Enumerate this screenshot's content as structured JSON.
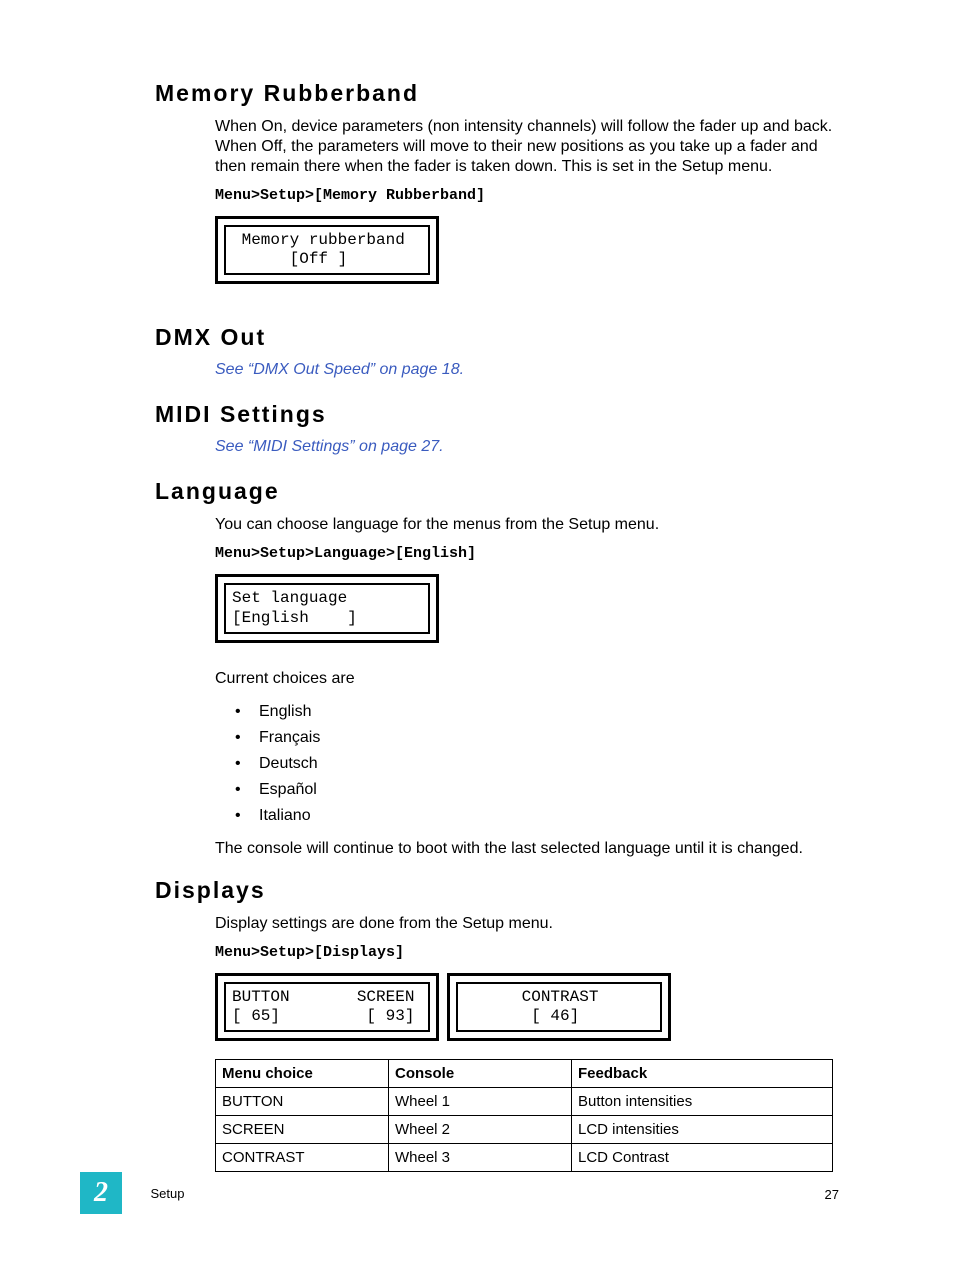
{
  "memory": {
    "heading": "Memory Rubberband",
    "para": "When On, device parameters (non intensity channels) will follow the fader up and back. When Off, the parameters will move to their new positions as you take up a fader and then remain there when the fader is taken down. This is set in the Setup menu.",
    "path": "Menu>Setup>[Memory Rubberband]",
    "lcd": " Memory rubberband\n      [Off ]"
  },
  "dmx": {
    "heading": "DMX Out",
    "link": "See “DMX Out Speed” on page 18."
  },
  "midi": {
    "heading": "MIDI Settings",
    "link": "See “MIDI Settings” on page 27."
  },
  "language": {
    "heading": "Language",
    "para1": "You can choose language for the menus from the Setup menu.",
    "path": "Menu>Setup>Language>[English]",
    "lcd": "Set language\n[English    ]",
    "choices_label": "Current choices are",
    "items": [
      "English",
      "Français",
      "Deutsch",
      "Español",
      "Italiano"
    ],
    "para2": "The console will continue to boot with the last selected language until it is changed."
  },
  "displays": {
    "heading": "Displays",
    "para": "Display settings are done from the Setup menu.",
    "path": "Menu>Setup>[Displays]",
    "lcd1": "BUTTON       SCREEN\n[ 65]         [ 93]",
    "lcd2": "      CONTRAST\n       [ 46]",
    "table": {
      "headers": [
        "Menu choice",
        "Console",
        "Feedback"
      ],
      "rows": [
        [
          "BUTTON",
          "Wheel 1",
          "Button intensities"
        ],
        [
          "SCREEN",
          "Wheel 2",
          "LCD intensities"
        ],
        [
          "CONTRAST",
          "Wheel 3",
          "LCD Contrast"
        ]
      ]
    }
  },
  "footer": {
    "chapter": "2",
    "section": "Setup",
    "page": "27"
  }
}
